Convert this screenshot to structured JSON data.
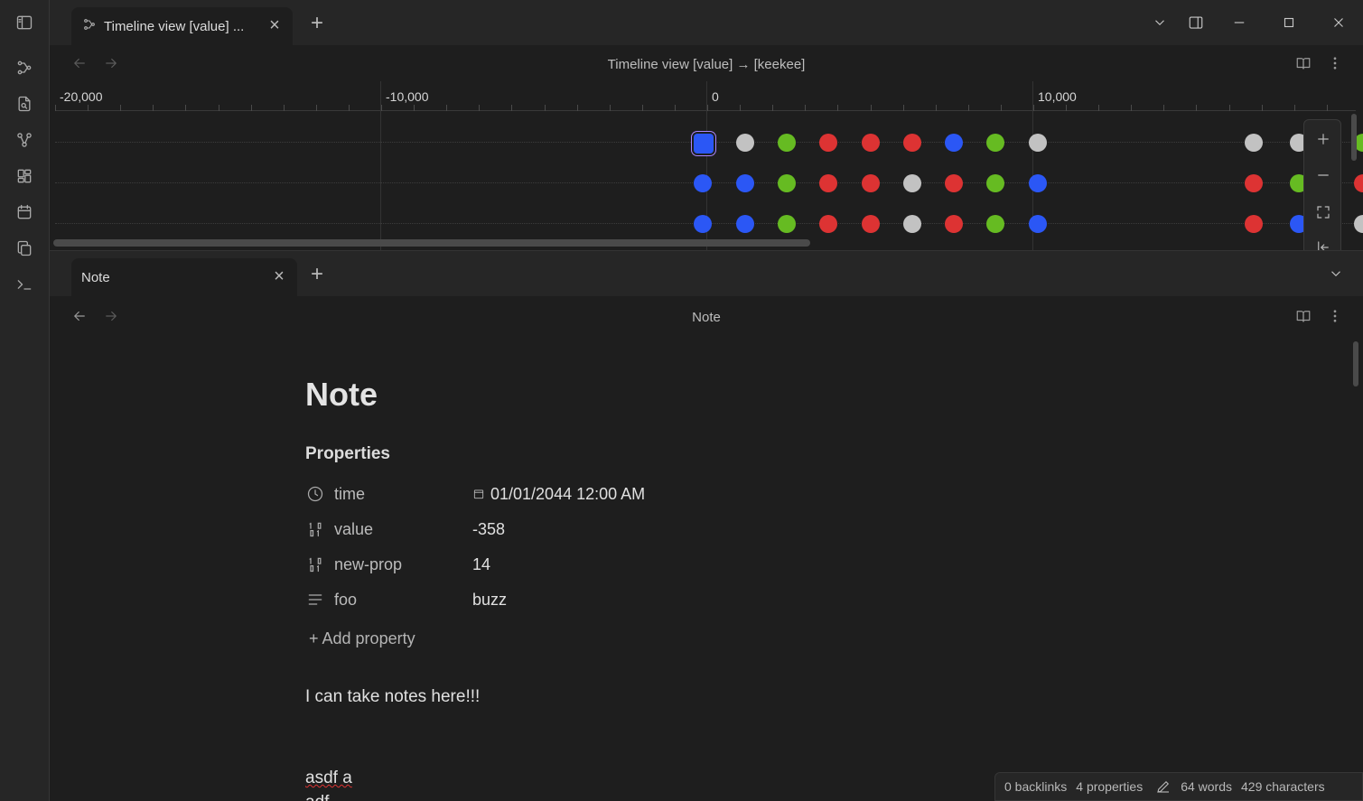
{
  "window": {
    "tab_title": "Timeline view [value] ...",
    "new_tab_label": "+",
    "close_tab_label": "×"
  },
  "timeline": {
    "view_title": "Timeline view [value] → [keekee]",
    "axis_labels": [
      "-20,000",
      "-10,000",
      "0",
      "10,000"
    ],
    "series_colors": {
      "blue": "#2b57f5",
      "gray": "#c2c2c2",
      "green": "#66bb22",
      "red": "#dd3333"
    },
    "rows": [
      [
        "blue",
        "gray",
        "green",
        "red",
        "red",
        "red",
        "blue",
        "green",
        "gray",
        "gray",
        "gray",
        "green"
      ],
      [
        "blue",
        "blue",
        "green",
        "red",
        "red",
        "gray",
        "red",
        "green",
        "blue",
        "red",
        "green",
        "red"
      ],
      [
        "blue",
        "blue",
        "green",
        "red",
        "red",
        "gray",
        "red",
        "green",
        "blue",
        "red",
        "blue",
        "gray"
      ]
    ]
  },
  "note_tab": {
    "title": "Note",
    "close_label": "×",
    "new_tab_label": "+"
  },
  "note": {
    "view_title": "Note",
    "heading": "Note",
    "properties_heading": "Properties",
    "properties": [
      {
        "icon": "clock-icon",
        "name": "time",
        "value": "01/01/2044 12:00 AM"
      },
      {
        "icon": "number-icon",
        "name": "value",
        "value": "-358"
      },
      {
        "icon": "number-icon",
        "name": "new-prop",
        "value": "14"
      },
      {
        "icon": "text-lines-icon",
        "name": "foo",
        "value": "buzz"
      }
    ],
    "add_property": "+ Add property",
    "body_line1": "I can take notes here!!!",
    "body_line2": "asdf a",
    "body_line3": "adf"
  },
  "status": {
    "backlinks": "0 backlinks",
    "properties": "4 properties",
    "words": "64 words",
    "characters": "429 characters"
  }
}
